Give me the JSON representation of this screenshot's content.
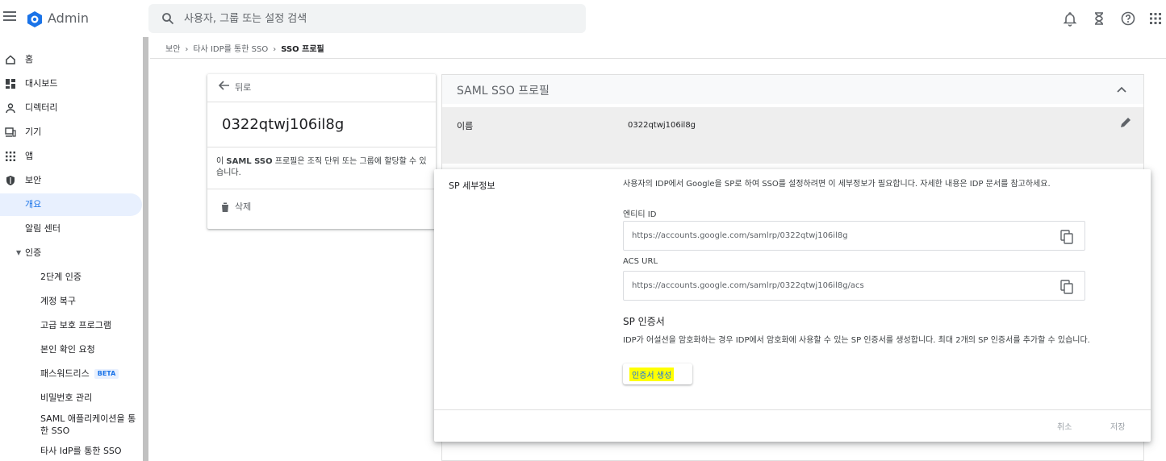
{
  "header": {
    "app_title": "Admin",
    "search_placeholder": "사용자, 그룹 또는 설정 검색",
    "brand_color": "#1a73e8"
  },
  "sidebar": {
    "items": [
      {
        "label": "홈",
        "icon": "home-icon"
      },
      {
        "label": "대시보드",
        "icon": "dashboard-icon"
      },
      {
        "label": "디렉터리",
        "icon": "person-icon"
      },
      {
        "label": "기기",
        "icon": "devices-icon"
      },
      {
        "label": "앱",
        "icon": "apps-grid-icon"
      },
      {
        "label": "보안",
        "icon": "shield-icon"
      },
      {
        "label": "개요",
        "icon": ""
      },
      {
        "label": "알림 센터",
        "icon": ""
      },
      {
        "label": "인증",
        "icon": "caret-down-icon"
      },
      {
        "label": "2단계 인증",
        "icon": ""
      },
      {
        "label": "계정 복구",
        "icon": ""
      },
      {
        "label": "고급 보호 프로그램",
        "icon": ""
      },
      {
        "label": "본인 확인 요청",
        "icon": ""
      },
      {
        "label": "패스워드리스",
        "icon": "",
        "badge": "BETA"
      },
      {
        "label": "비밀번호 관리",
        "icon": ""
      },
      {
        "label": "SAML 애플리케이션을 통한 SSO",
        "icon": ""
      },
      {
        "label": "타사 IdP를 통한 SSO",
        "icon": ""
      }
    ]
  },
  "breadcrumb": {
    "items": [
      "보안",
      "타사 IDP를 통한 SSO",
      "SSO 프로필"
    ]
  },
  "profile_card": {
    "back_label": "뒤로",
    "name": "0322qtwj106il8g",
    "description": "이 SAML SSO 프로필은 조직 단위 또는 그룹에 할당할 수 있습니다.",
    "description_bold": "SAML SSO",
    "delete_label": "삭제"
  },
  "panel": {
    "title": "SAML SSO 프로필",
    "name_label": "이름",
    "name_value": "0322qtwj106il8g"
  },
  "sp_details": {
    "title": "SP 세부정보",
    "description": "사용자의 IDP에서 Google을 SP로 하여 SSO를 설정하려면 이 세부정보가 필요합니다. 자세한 내용은 IDP 문서를 참고하세요.",
    "entity_id_label": "엔티티 ID",
    "entity_id_value": "https://accounts.google.com/samlrp/0322qtwj106il8g",
    "acs_url_label": "ACS URL",
    "acs_url_value": "https://accounts.google.com/samlrp/0322qtwj106il8g/acs",
    "cert_title": "SP 인증서",
    "cert_description": "IDP가 어설션을 암호화하는 경우 IDP에서 암호화에 사용할 수 있는 SP 인증서를 생성합니다. 최대 2개의 SP 인증서를 추가할 수 있습니다.",
    "cert_button": "인증서 생성",
    "cancel_label": "취소",
    "save_label": "저장"
  }
}
